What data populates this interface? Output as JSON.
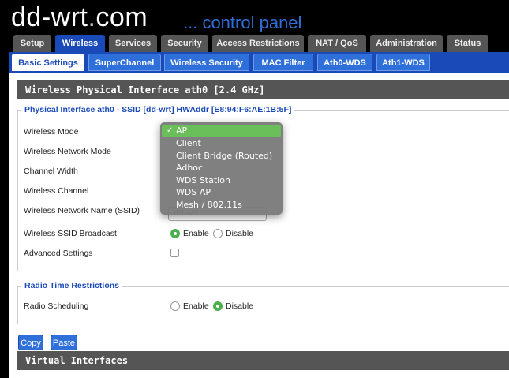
{
  "header": {
    "logo_main": "dd-wrt",
    "logo_dot": ".",
    "logo_tld": "com",
    "subtitle": "... control panel"
  },
  "main_tabs": [
    {
      "label": "Setup"
    },
    {
      "label": "Wireless"
    },
    {
      "label": "Services"
    },
    {
      "label": "Security"
    },
    {
      "label": "Access Restrictions"
    },
    {
      "label": "NAT / QoS"
    },
    {
      "label": "Administration"
    },
    {
      "label": "Status"
    }
  ],
  "sub_tabs": [
    {
      "label": "Basic Settings"
    },
    {
      "label": "SuperChannel"
    },
    {
      "label": "Wireless Security"
    },
    {
      "label": "MAC Filter"
    },
    {
      "label": "Ath0-WDS"
    },
    {
      "label": "Ath1-WDS"
    }
  ],
  "section1": {
    "title": "Wireless Physical Interface ath0 [2.4 GHz]",
    "legend": "Physical Interface ath0 - SSID [dd-wrt] HWAddr [E8:94:F6:AE:1B:5F]",
    "labels": {
      "mode": "Wireless Mode",
      "network_mode": "Wireless Network Mode",
      "channel_width": "Channel Width",
      "channel": "Wireless Channel",
      "ssid": "Wireless Network Name (SSID)",
      "ssid_broadcast": "Wireless SSID Broadcast",
      "advanced": "Advanced Settings"
    },
    "ssid_value": "dd-wrt",
    "broadcast": {
      "enable": "Enable",
      "disable": "Disable",
      "selected": "Enable"
    },
    "advanced_checked": false
  },
  "mode_dropdown": {
    "selected": "AP",
    "check": "✓",
    "options": [
      "AP",
      "Client",
      "Client Bridge (Routed)",
      "Adhoc",
      "WDS Station",
      "WDS AP",
      "Mesh / 802.11s"
    ]
  },
  "section2": {
    "legend": "Radio Time Restrictions",
    "label": "Radio Scheduling",
    "enable": "Enable",
    "disable": "Disable",
    "selected": "Disable"
  },
  "buttons": {
    "copy": "Copy",
    "paste": "Paste"
  },
  "section3": {
    "title": "Virtual Interfaces"
  },
  "colors": {
    "accent": "#1a4ab8",
    "tab_blue": "#2f6fd9",
    "selected_green": "#6abf5a",
    "radio_green": "#4caf50",
    "title_gray": "#555555"
  }
}
